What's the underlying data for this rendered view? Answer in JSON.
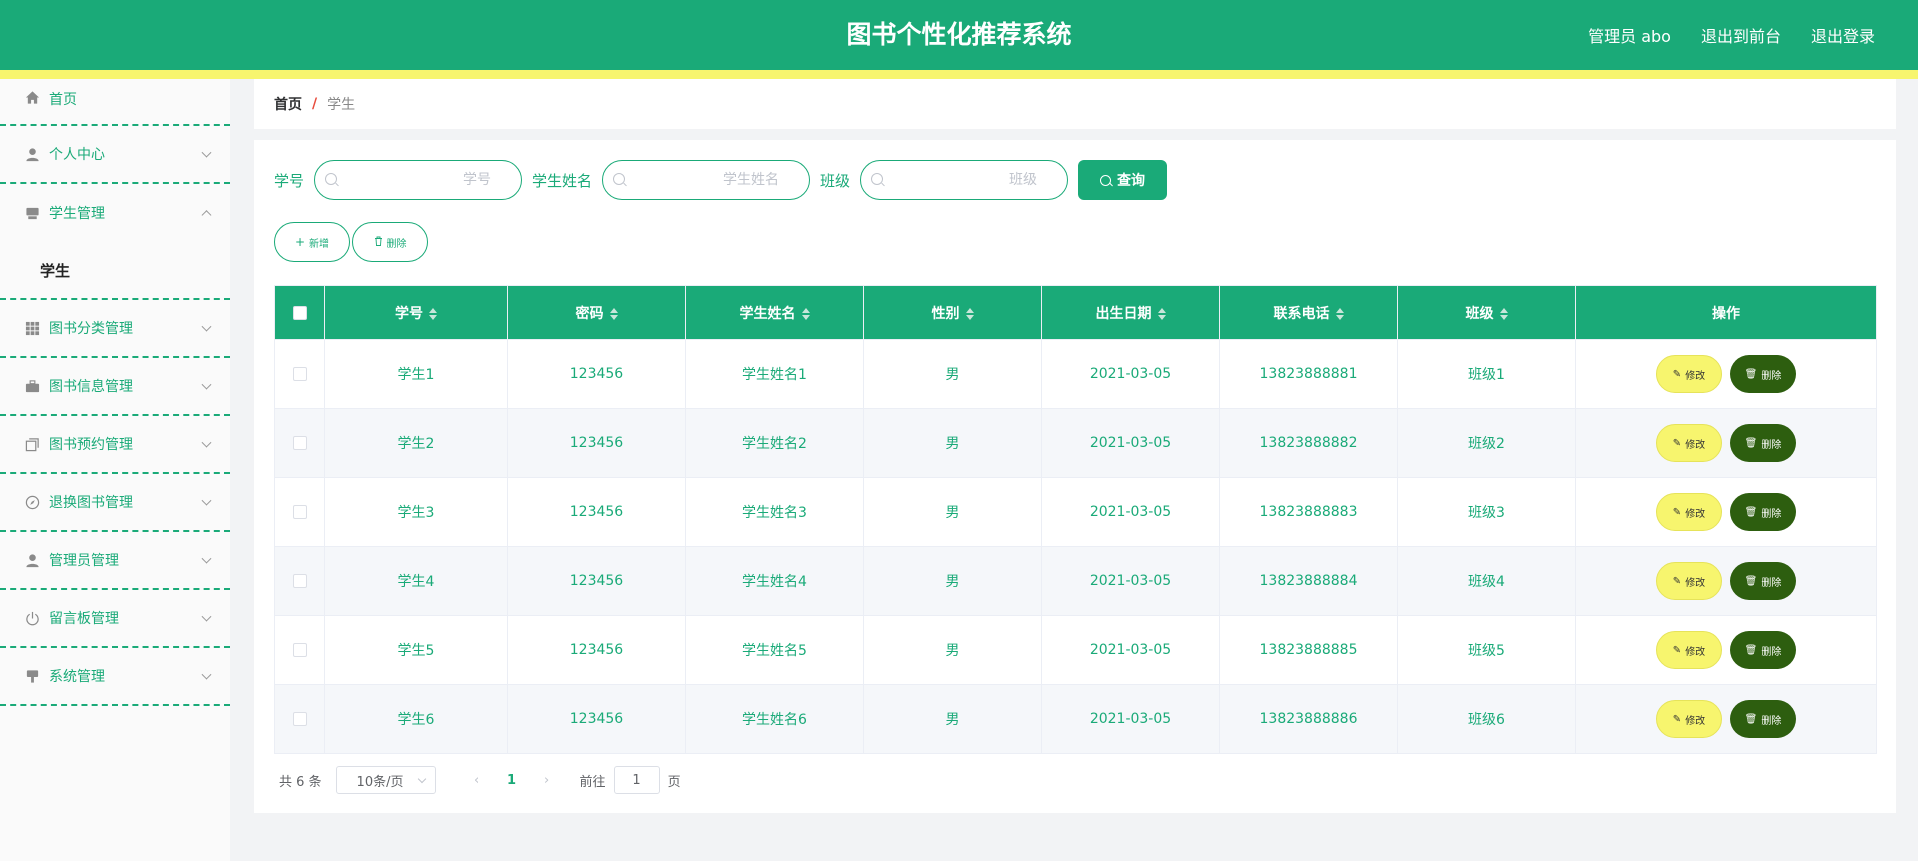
{
  "header": {
    "title": "图书个性化推荐系统",
    "user": "管理员 abo",
    "front": "退出到前台",
    "logout": "退出登录"
  },
  "sidebar": {
    "items": [
      {
        "label": "首页",
        "icon": "home-icon"
      },
      {
        "label": "个人中心",
        "icon": "user-icon"
      },
      {
        "label": "学生管理",
        "icon": "inbox-icon",
        "expanded": true,
        "children": [
          "学生"
        ]
      },
      {
        "label": "图书分类管理",
        "icon": "grid-icon"
      },
      {
        "label": "图书信息管理",
        "icon": "briefcase-icon"
      },
      {
        "label": "图书预约管理",
        "icon": "copy-icon"
      },
      {
        "label": "退换图书管理",
        "icon": "compass-icon"
      },
      {
        "label": "管理员管理",
        "icon": "user-icon"
      },
      {
        "label": "留言板管理",
        "icon": "power-icon"
      },
      {
        "label": "系统管理",
        "icon": "brush-icon"
      }
    ]
  },
  "breadcrumb": {
    "home": "首页",
    "sep": "/",
    "current": "学生"
  },
  "search": {
    "fields": [
      {
        "label": "学号",
        "placeholder": "学号"
      },
      {
        "label": "学生姓名",
        "placeholder": "学生姓名"
      },
      {
        "label": "班级",
        "placeholder": "班级"
      }
    ],
    "query": "查询"
  },
  "actions": {
    "add": "新增",
    "delete": "删除"
  },
  "table": {
    "headers": [
      "学号",
      "密码",
      "学生姓名",
      "性别",
      "出生日期",
      "联系电话",
      "班级",
      "操作"
    ],
    "rows": [
      [
        "学生1",
        "123456",
        "学生姓名1",
        "男",
        "2021-03-05",
        "13823888881",
        "班级1"
      ],
      [
        "学生2",
        "123456",
        "学生姓名2",
        "男",
        "2021-03-05",
        "13823888882",
        "班级2"
      ],
      [
        "学生3",
        "123456",
        "学生姓名3",
        "男",
        "2021-03-05",
        "13823888883",
        "班级3"
      ],
      [
        "学生4",
        "123456",
        "学生姓名4",
        "男",
        "2021-03-05",
        "13823888884",
        "班级4"
      ],
      [
        "学生5",
        "123456",
        "学生姓名5",
        "男",
        "2021-03-05",
        "13823888885",
        "班级5"
      ],
      [
        "学生6",
        "123456",
        "学生姓名6",
        "男",
        "2021-03-05",
        "13823888886",
        "班级6"
      ]
    ],
    "edit": "修改",
    "delete": "删除"
  },
  "pagination": {
    "total": "共 6 条",
    "page_size": "10条/页",
    "current": "1",
    "goto": "前往",
    "goto_value": "1",
    "page_unit": "页"
  },
  "colors": {
    "primary": "#1aaa78",
    "accent_yellow": "#f7f56e",
    "danger_dark": "#2d5e0f"
  }
}
